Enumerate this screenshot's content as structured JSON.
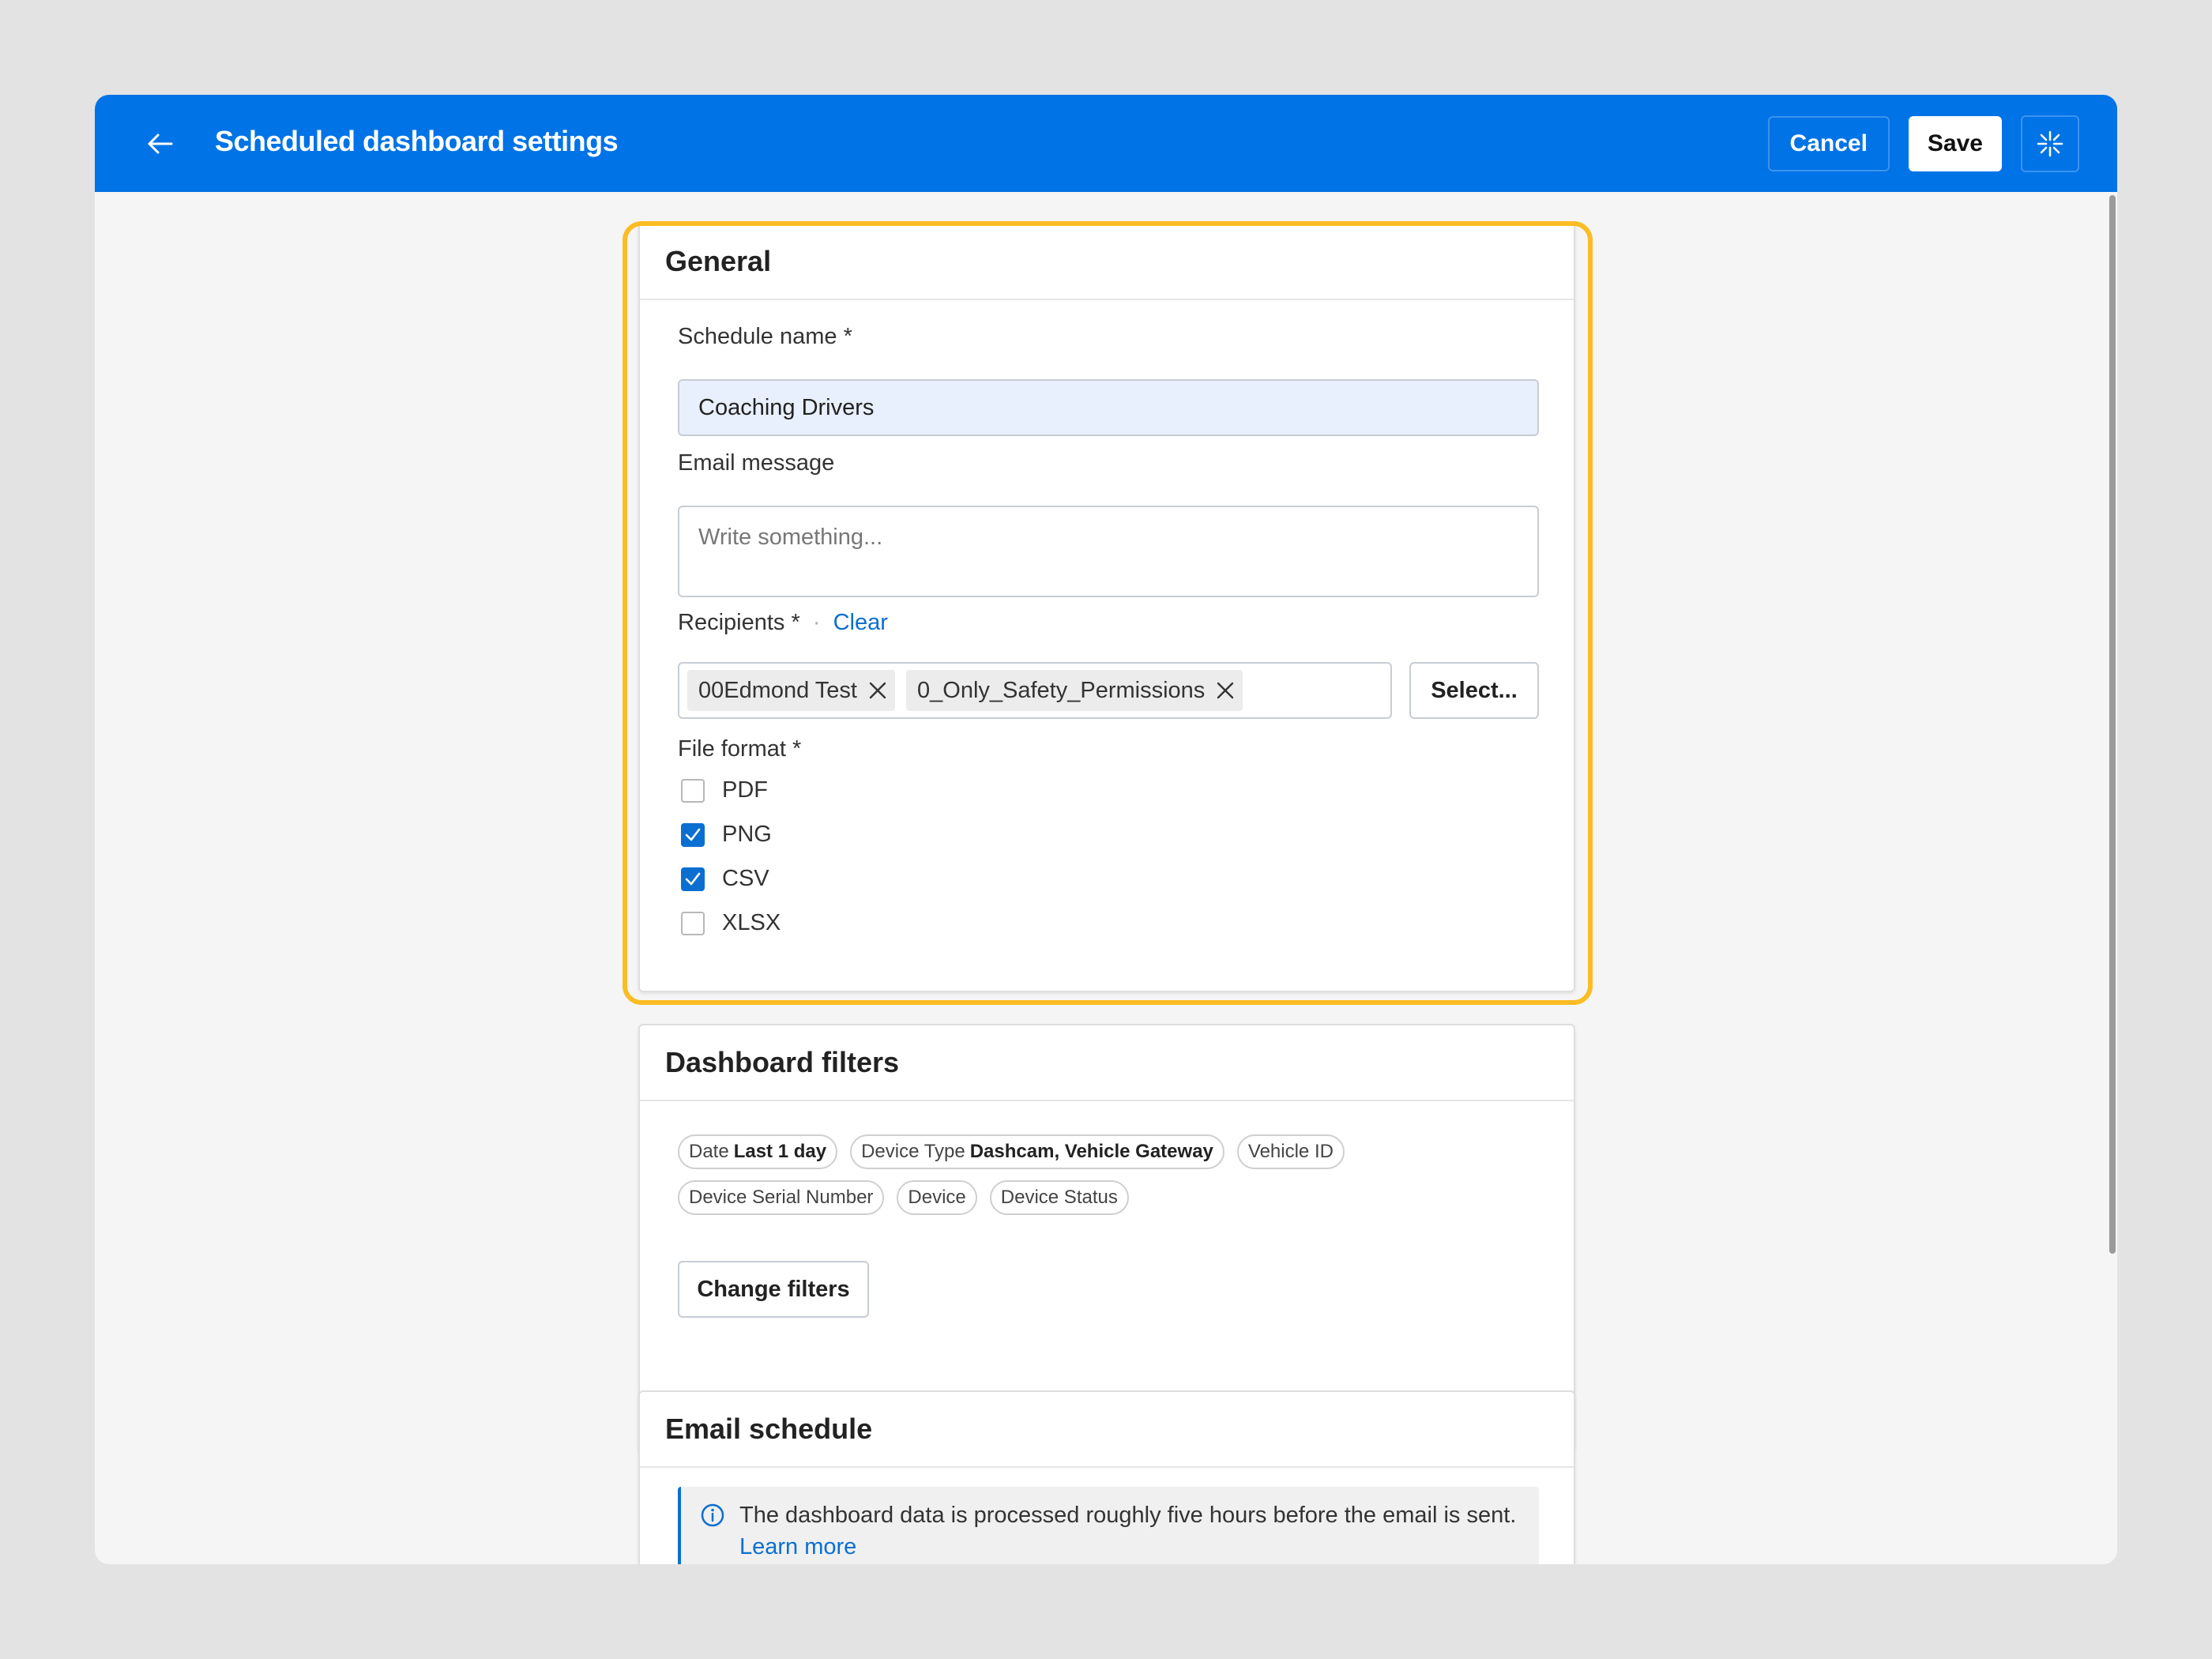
{
  "header": {
    "title": "Scheduled dashboard settings",
    "cancel_label": "Cancel",
    "save_label": "Save",
    "back_icon": "arrow-left-icon",
    "ai_icon": "sparkle-icon"
  },
  "general": {
    "title": "General",
    "schedule_name_label": "Schedule name",
    "schedule_name_value": "Coaching Drivers",
    "email_message_label": "Email message",
    "email_message_placeholder": "Write something...",
    "recipients_label": "Recipients",
    "clear_label": "Clear",
    "separator": "·",
    "required_mark": "*",
    "recipients": [
      {
        "name": "00Edmond Test"
      },
      {
        "name": "0_Only_Safety_Permissions"
      }
    ],
    "select_label": "Select...",
    "file_format_label": "File format",
    "file_formats": [
      {
        "label": "PDF",
        "checked": false
      },
      {
        "label": "PNG",
        "checked": true
      },
      {
        "label": "CSV",
        "checked": true
      },
      {
        "label": "XLSX",
        "checked": false
      }
    ]
  },
  "filters": {
    "title": "Dashboard filters",
    "pills": [
      {
        "name": "Date",
        "value": "Last 1 day"
      },
      {
        "name": "Device Type",
        "value": "Dashcam, Vehicle Gateway"
      },
      {
        "name": "Vehicle ID",
        "value": ""
      },
      {
        "name": "Device Serial Number",
        "value": ""
      },
      {
        "name": "Device",
        "value": ""
      },
      {
        "name": "Device Status",
        "value": ""
      }
    ],
    "change_label": "Change filters"
  },
  "schedule": {
    "title": "Email schedule",
    "info_text": "The dashboard data is processed roughly five hours before the email is sent.",
    "learn_more": "Learn more"
  },
  "colors": {
    "brand": "#0073e6",
    "highlight": "#fbbd23",
    "link": "#0b6fd1"
  }
}
